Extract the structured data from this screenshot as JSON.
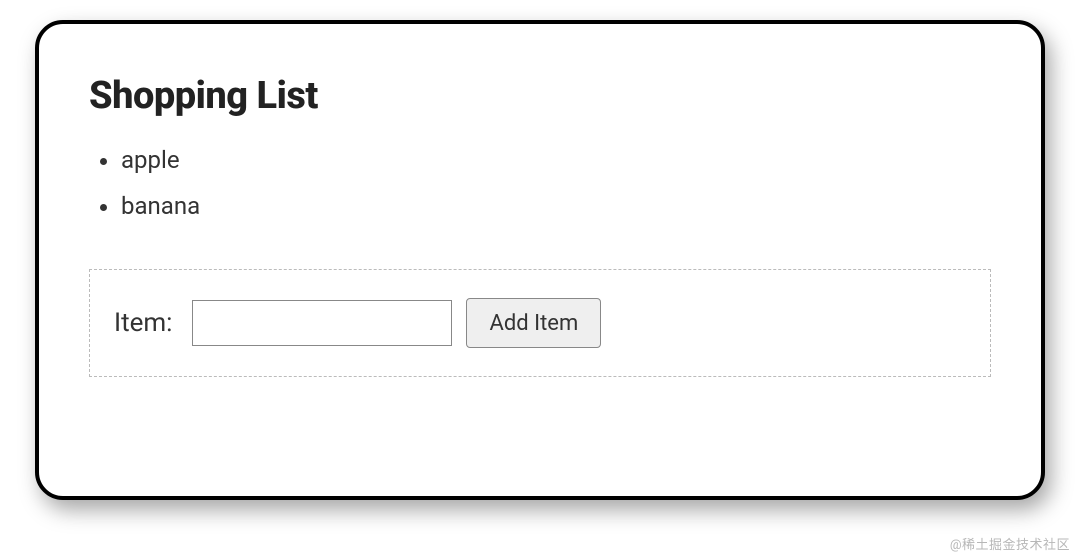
{
  "title": "Shopping List",
  "items": [
    "apple",
    "banana"
  ],
  "form": {
    "label": "Item:",
    "input_value": "",
    "button_label": "Add Item"
  },
  "watermark": "@稀土掘金技术社区"
}
